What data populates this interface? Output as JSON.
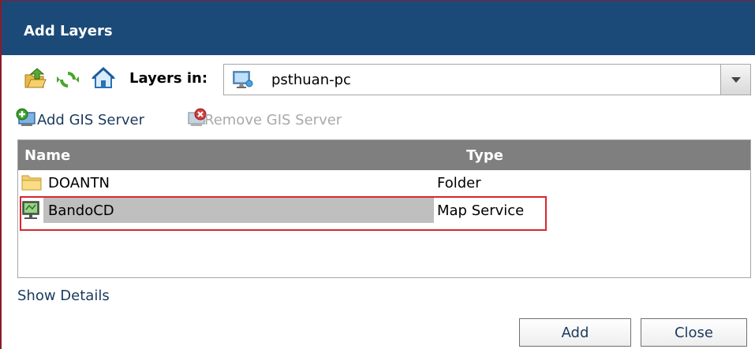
{
  "dialog": {
    "title": "Add Layers"
  },
  "toolbar": {
    "icons": [
      "folder-up-icon",
      "refresh-icon",
      "home-icon"
    ],
    "layers_in_label": "Layers in:",
    "location_value": "psthuan-pc",
    "location_icon": "computer-icon"
  },
  "server_actions": {
    "add_label": "Add GIS Server",
    "remove_label": "Remove GIS Server"
  },
  "grid": {
    "columns": [
      "Name",
      "Type"
    ],
    "rows": [
      {
        "name": "DOANTN",
        "type": "Folder",
        "icon": "folder-icon",
        "selected": false
      },
      {
        "name": "BandoCD",
        "type": "Map Service",
        "icon": "map-service-icon",
        "selected": true
      }
    ]
  },
  "links": {
    "show_details": "Show Details"
  },
  "buttons": {
    "add": "Add",
    "close": "Close"
  },
  "colors": {
    "titlebar": "#1b4a78",
    "header": "#7f7f7f",
    "selection": "#bfbfbf",
    "highlight_border": "#d9262e",
    "link": "#1b3a5e"
  }
}
